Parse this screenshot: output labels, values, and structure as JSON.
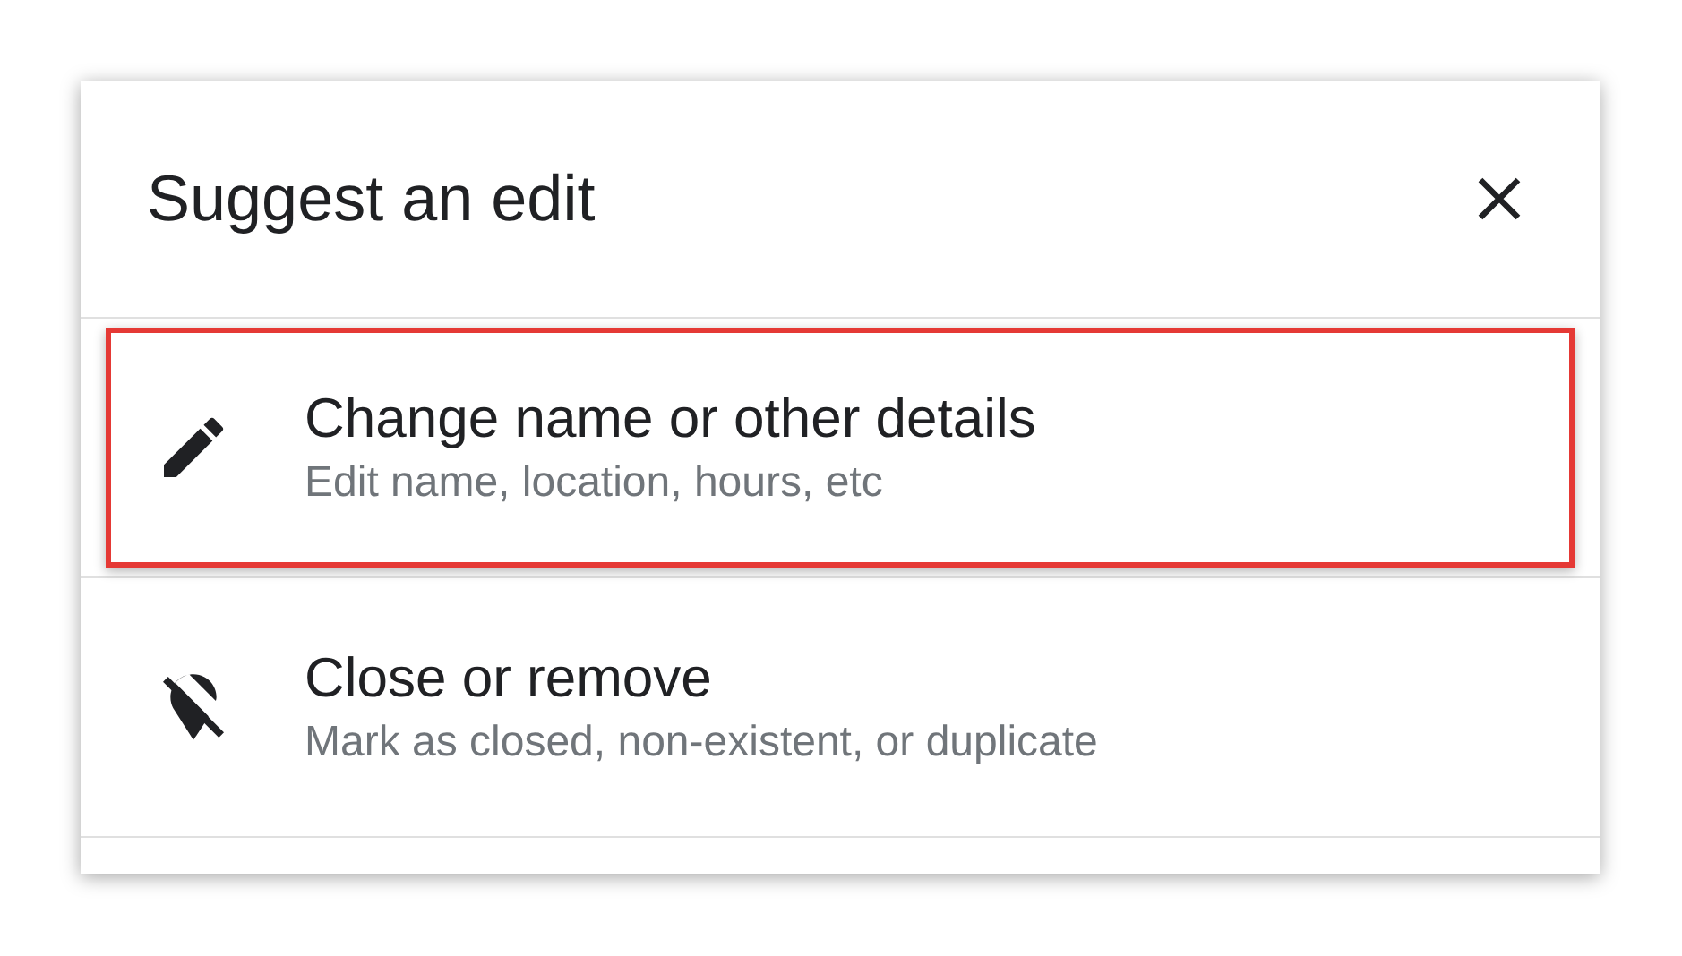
{
  "dialog": {
    "title": "Suggest an edit",
    "options": [
      {
        "kind": "edit",
        "title": "Change name or other details",
        "subtitle": "Edit name, location, hours, etc",
        "highlighted": true
      },
      {
        "kind": "remove",
        "title": "Close or remove",
        "subtitle": "Mark as closed, non-existent, or duplicate",
        "highlighted": false
      }
    ]
  }
}
